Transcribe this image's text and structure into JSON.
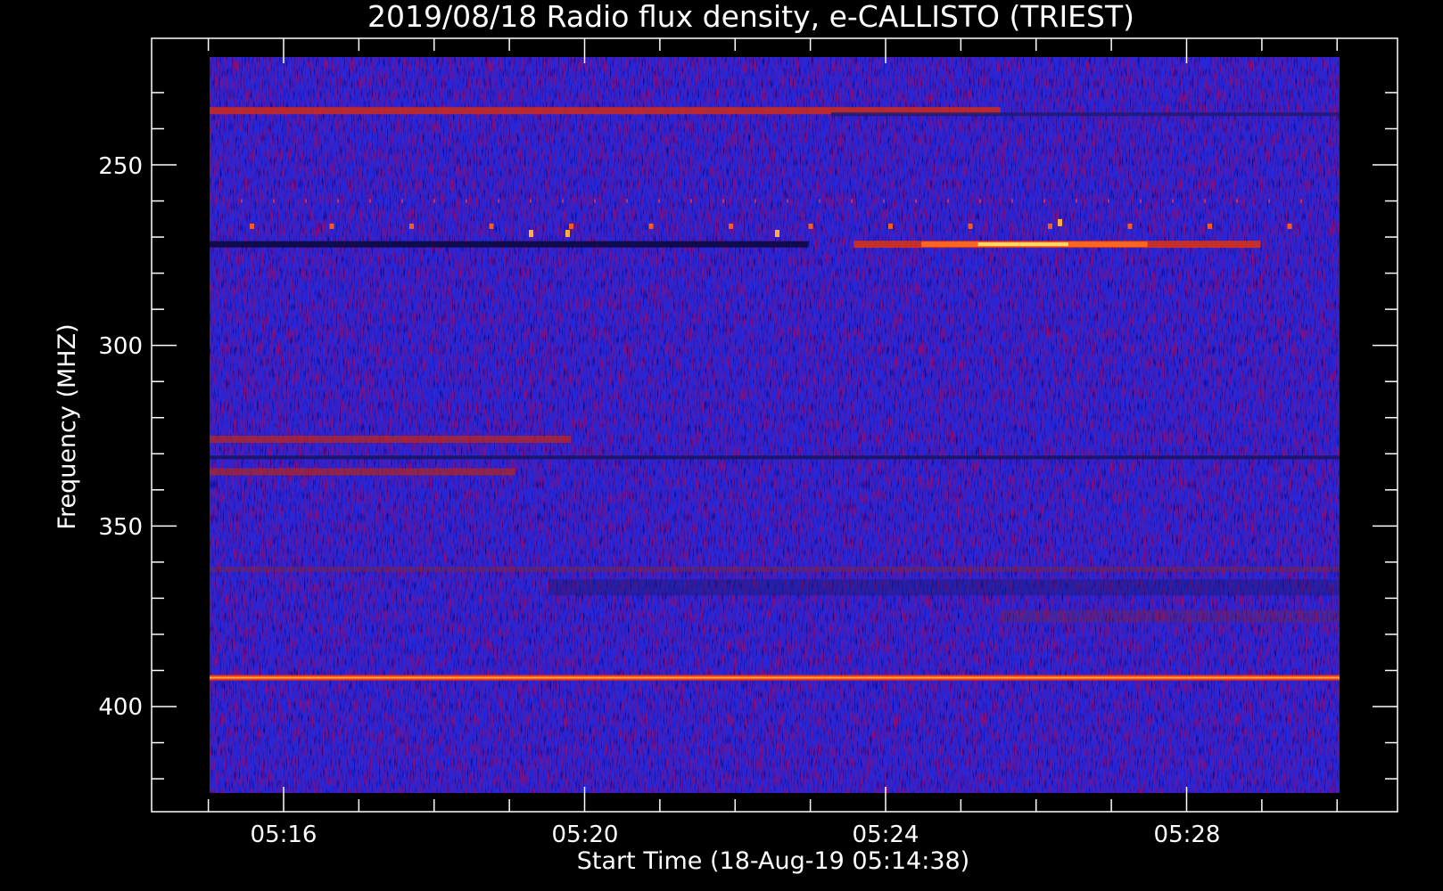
{
  "chart_data": {
    "type": "heatmap",
    "title": "2019/08/18  Radio flux density, e-CALLISTO (TRIEST)",
    "xlabel": "Start Time (18-Aug-19 05:14:38)",
    "ylabel": "Frequency (MHZ)",
    "x_ticks": [
      "05:16",
      "05:20",
      "05:24",
      "05:28"
    ],
    "y_ticks": [
      "250",
      "300",
      "350",
      "400"
    ],
    "y_axis_inverted": true,
    "ylim": [
      220,
      426
    ],
    "xlim_minutes": [
      0,
      15
    ],
    "colors": {
      "background": "#000000",
      "spectrogram_base": "#2626d8",
      "low": "#0a0a50",
      "high": "#ff3b00",
      "peak": "#ffe066",
      "axes": "#ffffff"
    },
    "features": [
      {
        "name": "interference band",
        "frequency": 235,
        "level": "high"
      },
      {
        "name": "dark band",
        "frequency": 272,
        "level": "low"
      },
      {
        "name": "bright emission band",
        "frequency": 272,
        "level": "very high"
      },
      {
        "name": "band",
        "frequency": 326,
        "level": "high"
      },
      {
        "name": "band",
        "frequency": 335,
        "level": "high"
      },
      {
        "name": "bright interference line",
        "frequency": 392,
        "level": "very high"
      }
    ]
  }
}
